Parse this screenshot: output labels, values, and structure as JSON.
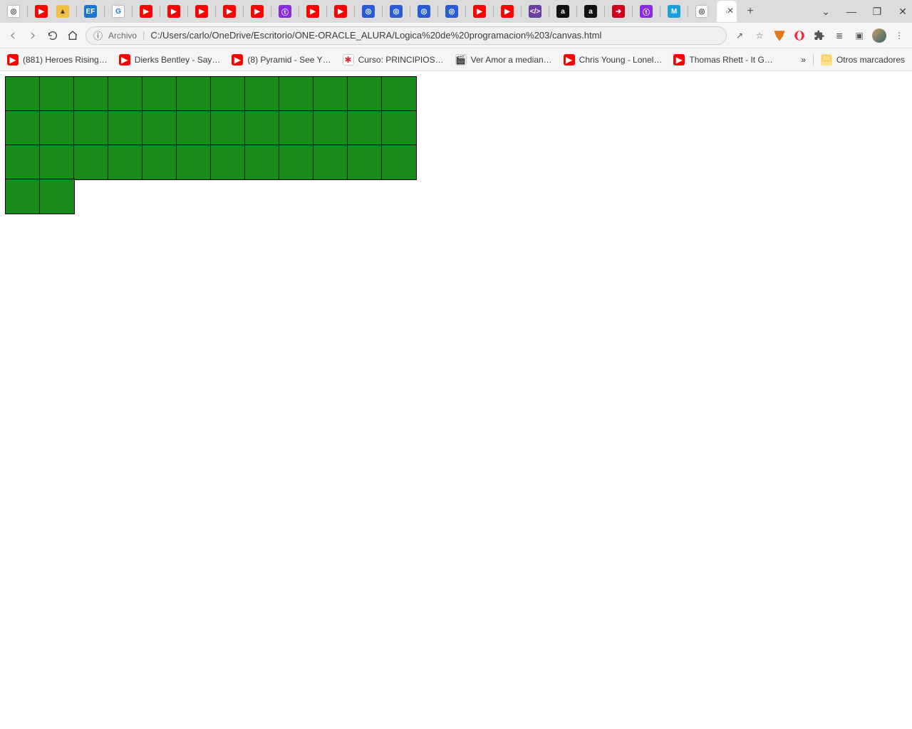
{
  "window": {
    "caret": "⌄",
    "min": "—",
    "max": "❐",
    "close": "✕"
  },
  "tabstrip": {
    "newtab": "+",
    "active_close": "✕",
    "icons": [
      {
        "bg": "#ffffff",
        "fg": "#444",
        "txt": "◎",
        "sep": false
      },
      {
        "bg": "#ff0000",
        "fg": "#fff",
        "txt": "▶",
        "sep": true
      },
      {
        "bg": "#f0c040",
        "fg": "#333",
        "txt": "▲",
        "sep": false
      },
      {
        "bg": "#1976d2",
        "fg": "#fff",
        "txt": "EF",
        "sep": true
      },
      {
        "bg": "#ffffff",
        "fg": "#1a73e8",
        "txt": "G",
        "sep": true
      },
      {
        "bg": "#ff0000",
        "fg": "#fff",
        "txt": "▶",
        "sep": true
      },
      {
        "bg": "#ff0000",
        "fg": "#fff",
        "txt": "▶",
        "sep": true
      },
      {
        "bg": "#ff0000",
        "fg": "#fff",
        "txt": "▶",
        "sep": true
      },
      {
        "bg": "#ff0000",
        "fg": "#fff",
        "txt": "▶",
        "sep": true
      },
      {
        "bg": "#ff0000",
        "fg": "#fff",
        "txt": "▶",
        "sep": true
      },
      {
        "bg": "#8a2be2",
        "fg": "#fff",
        "txt": "ⓣ",
        "sep": true
      },
      {
        "bg": "#ff0000",
        "fg": "#fff",
        "txt": "▶",
        "sep": true
      },
      {
        "bg": "#ff0000",
        "fg": "#fff",
        "txt": "▶",
        "sep": true
      },
      {
        "bg": "#2a5bd7",
        "fg": "#fff",
        "txt": "◎",
        "sep": true
      },
      {
        "bg": "#2a5bd7",
        "fg": "#fff",
        "txt": "◎",
        "sep": true
      },
      {
        "bg": "#2a5bd7",
        "fg": "#fff",
        "txt": "◎",
        "sep": true
      },
      {
        "bg": "#2a5bd7",
        "fg": "#fff",
        "txt": "◎",
        "sep": true
      },
      {
        "bg": "#ff0000",
        "fg": "#fff",
        "txt": "▶",
        "sep": true
      },
      {
        "bg": "#ff0000",
        "fg": "#fff",
        "txt": "▶",
        "sep": true
      },
      {
        "bg": "#6b3fa0",
        "fg": "#fff",
        "txt": "</>",
        "sep": true
      },
      {
        "bg": "#111",
        "fg": "#fff",
        "txt": "a",
        "sep": true
      },
      {
        "bg": "#111",
        "fg": "#fff",
        "txt": "a",
        "sep": true
      },
      {
        "bg": "#d0021b",
        "fg": "#fff",
        "txt": "➔",
        "sep": true
      },
      {
        "bg": "#8a2be2",
        "fg": "#fff",
        "txt": "ⓣ",
        "sep": true
      },
      {
        "bg": "#1aa0e0",
        "fg": "#fff",
        "txt": "M",
        "sep": true
      },
      {
        "bg": "#ffffff",
        "fg": "#444",
        "txt": "◎",
        "sep": true
      }
    ]
  },
  "toolbar": {
    "info_glyph": "ⓘ",
    "chip_label": "Archivo",
    "url": "C:/Users/carlo/OneDrive/Escritorio/ONE-ORACLE_ALURA/Logica%20de%20programacion%203/canvas.html",
    "share_glyph": "↗",
    "star_glyph": "☆",
    "puzzle_sets": "≡",
    "reading_glyph": "≣",
    "panel_glyph": "▣",
    "menu_glyph": "⋮"
  },
  "bookmarks": {
    "items": [
      {
        "icon": "▶",
        "bg": "#ff0000",
        "label": "(881) Heroes Rising…"
      },
      {
        "icon": "▶",
        "bg": "#ff0000",
        "label": "Dierks Bentley - Say…"
      },
      {
        "icon": "▶",
        "bg": "#ff0000",
        "label": "(8) Pyramid - See Y…"
      },
      {
        "icon": "✱",
        "bg": "#ffffff",
        "label": "Curso: PRINCIPIOS…",
        "fg": "#d23"
      },
      {
        "icon": "🎬",
        "bg": "#ffffff",
        "label": "Ver Amor a median…",
        "fg": "#333"
      },
      {
        "icon": "▶",
        "bg": "#ff0000",
        "label": "Chris Young - Lonel…"
      },
      {
        "icon": "▶",
        "bg": "#ff0000",
        "label": "Thomas Rhett - It G…"
      }
    ],
    "overflow_glyph": "»",
    "other_label": "Otros marcadores",
    "folder_glyph": "🗀"
  },
  "canvas": {
    "cell_color": "#178a17",
    "rows": [
      12,
      12,
      12,
      2
    ]
  }
}
